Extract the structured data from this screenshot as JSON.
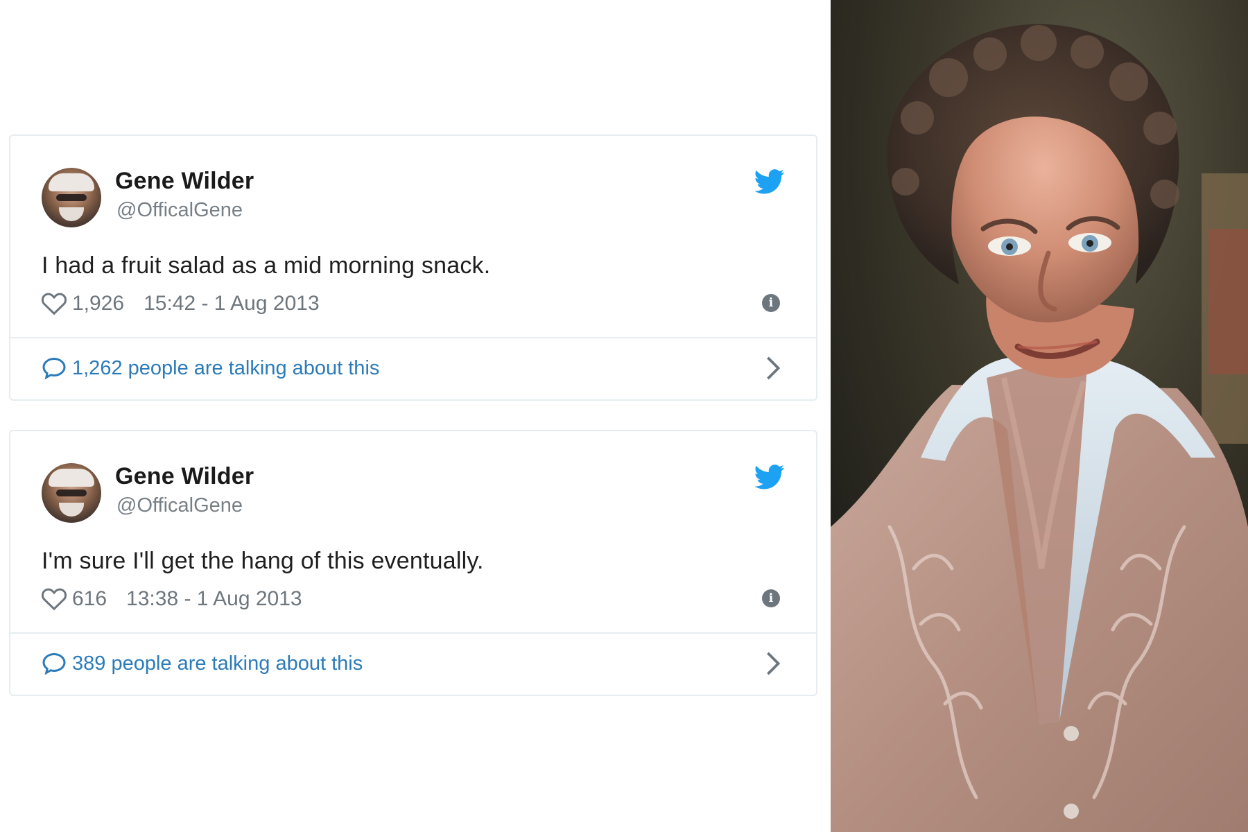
{
  "tweets": [
    {
      "user_name": "Gene Wilder",
      "user_handle": "@OfficalGene",
      "text": "I had a fruit salad as a mid morning snack.",
      "likes": "1,926",
      "timestamp": "15:42 - 1 Aug 2013",
      "conversation": "1,262 people are talking about this"
    },
    {
      "user_name": "Gene Wilder",
      "user_handle": "@OfficalGene",
      "text": "I'm sure I'll get the hang of this eventually.",
      "likes": "616",
      "timestamp": "13:38 - 1 Aug 2013",
      "conversation": "389 people are talking about this"
    }
  ],
  "icons": {
    "bird": "twitter-bird-icon",
    "heart": "heart-icon",
    "info": "info-icon",
    "bubble": "speech-bubble-icon",
    "chevron": "chevron-right-icon"
  },
  "colors": {
    "twitter_blue": "#1da1f2",
    "link_blue": "#2b7bb9",
    "card_border": "#e6ecf0",
    "text_gray": "#6e767d"
  }
}
